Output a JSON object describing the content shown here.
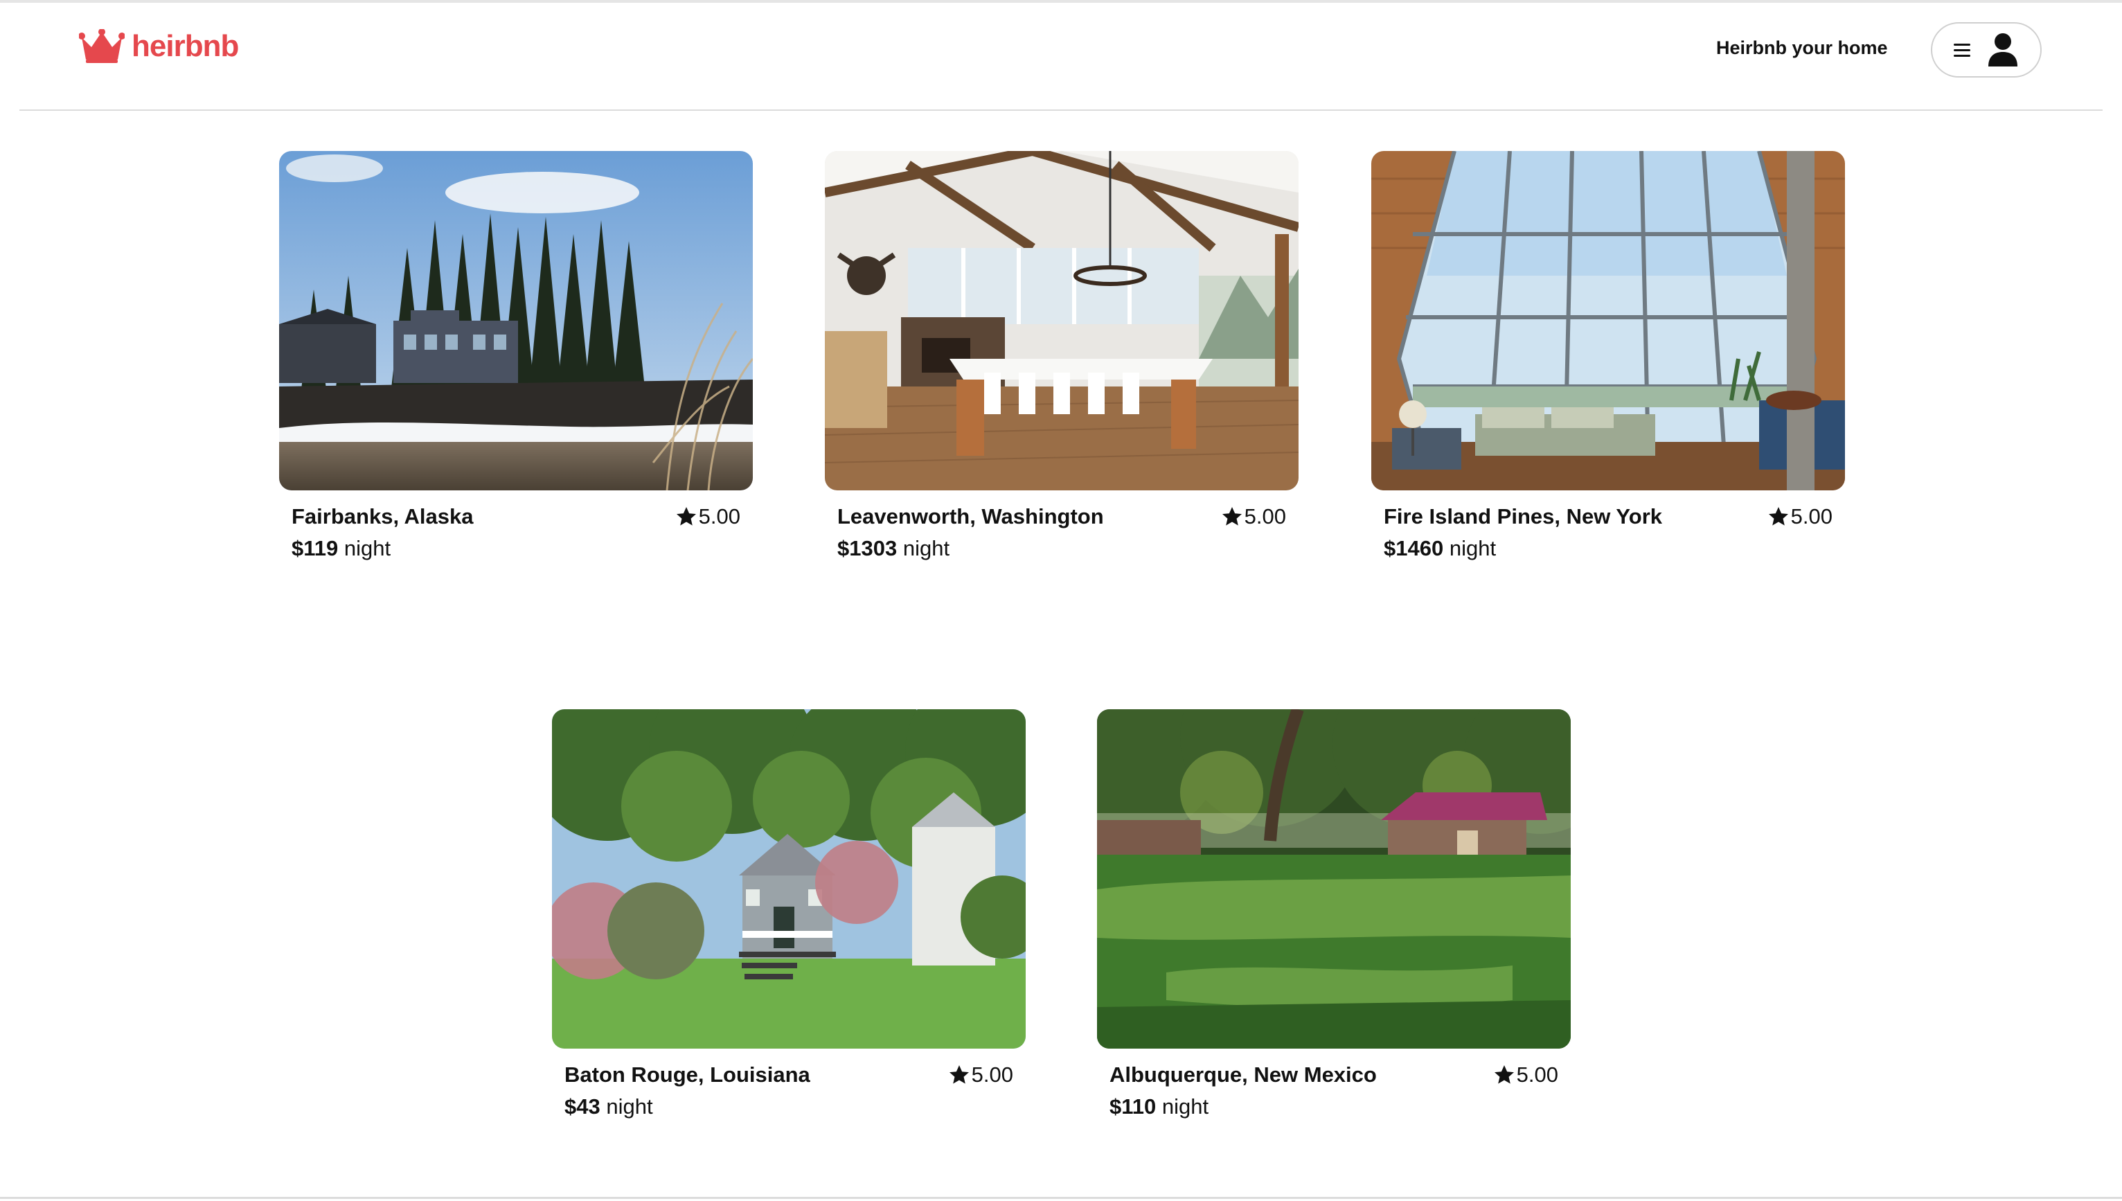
{
  "app": {
    "brand": "heirbnb",
    "brand_color": "#e5484d",
    "logo_icon": "crown-icon"
  },
  "header": {
    "host_link": "Heirbnb your home",
    "menu_icon": "hamburger-icon",
    "avatar_icon": "user-icon"
  },
  "listings": [
    {
      "location": "Fairbanks, Alaska",
      "rating": "5.00",
      "price": "$119",
      "price_unit": "night",
      "photo": "snowy riverside cabins with spruce trees"
    },
    {
      "location": "Leavenworth, Washington",
      "rating": "5.00",
      "price": "$1303",
      "price_unit": "night",
      "photo": "timber great room with long dining table"
    },
    {
      "location": "Fire Island Pines, New York",
      "rating": "5.00",
      "price": "$1460",
      "price_unit": "night",
      "photo": "A-frame glass wall living room"
    },
    {
      "location": "Baton Rouge, Louisiana",
      "rating": "5.00",
      "price": "$43",
      "price_unit": "night",
      "photo": "small grey cottage with garden"
    },
    {
      "location": "Albuquerque, New Mexico",
      "rating": "5.00",
      "price": "$110",
      "price_unit": "night",
      "photo": "large lawn with shade trees and red-roof casita"
    }
  ],
  "colors": {
    "accent": "#e5484d",
    "text": "#111111",
    "divider": "#dcdcdc"
  }
}
